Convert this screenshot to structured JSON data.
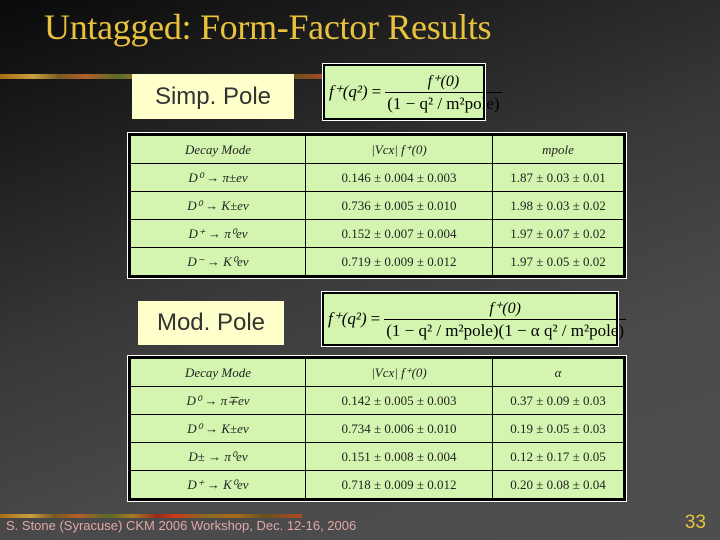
{
  "slide": {
    "title": "Untagged: Form-Factor Results",
    "footer": "S. Stone (Syracuse) CKM 2006 Workshop, Dec. 12-16, 2006",
    "page_number": "33",
    "colors": {
      "title": "#e8c23c",
      "label_box": "#ffffcc",
      "table_bg": "#d4f5b0",
      "footer_text": "#e0a8a8"
    }
  },
  "simple_pole": {
    "label": "Simp. Pole",
    "formula": {
      "lhs": "f⁺(q²)",
      "eq": "=",
      "numerator": "f⁺(0)",
      "denominator": "(1 − q² / m²pole)"
    },
    "table": {
      "headers": [
        "Decay Mode",
        "|Vcx| f⁺(0)",
        "mpole"
      ],
      "rows": [
        [
          "D⁰ → π±eν",
          "0.146 ± 0.004 ± 0.003",
          "1.87 ± 0.03 ± 0.01"
        ],
        [
          "D⁰ → K±eν",
          "0.736 ± 0.005 ± 0.010",
          "1.98 ± 0.03 ± 0.02"
        ],
        [
          "D⁺ → π⁰eν",
          "0.152 ± 0.007 ± 0.004",
          "1.97 ± 0.07 ± 0.02"
        ],
        [
          "D⁻ → K⁰eν",
          "0.719 ± 0.009 ± 0.012",
          "1.97 ± 0.05 ± 0.02"
        ]
      ]
    }
  },
  "modified_pole": {
    "label": "Mod. Pole",
    "formula": {
      "lhs": "f⁺(q²)",
      "eq": "=",
      "numerator": "f⁺(0)",
      "denominator": "(1 − q² / m²pole)(1 − α q² / m²pole)"
    },
    "table": {
      "headers": [
        "Decay Mode",
        "|Vcx| f⁺(0)",
        "α"
      ],
      "rows": [
        [
          "D⁰ → π∓eν",
          "0.142 ± 0.005 ± 0.003",
          "0.37 ± 0.09 ± 0.03"
        ],
        [
          "D⁰ → K±eν",
          "0.734 ± 0.006 ± 0.010",
          "0.19 ± 0.05 ± 0.03"
        ],
        [
          "D± → π⁰eν",
          "0.151 ± 0.008 ± 0.004",
          "0.12 ± 0.17 ± 0.05"
        ],
        [
          "D⁺ → K⁰eν",
          "0.718 ± 0.009 ± 0.012",
          "0.20 ± 0.08 ± 0.04"
        ]
      ]
    }
  }
}
